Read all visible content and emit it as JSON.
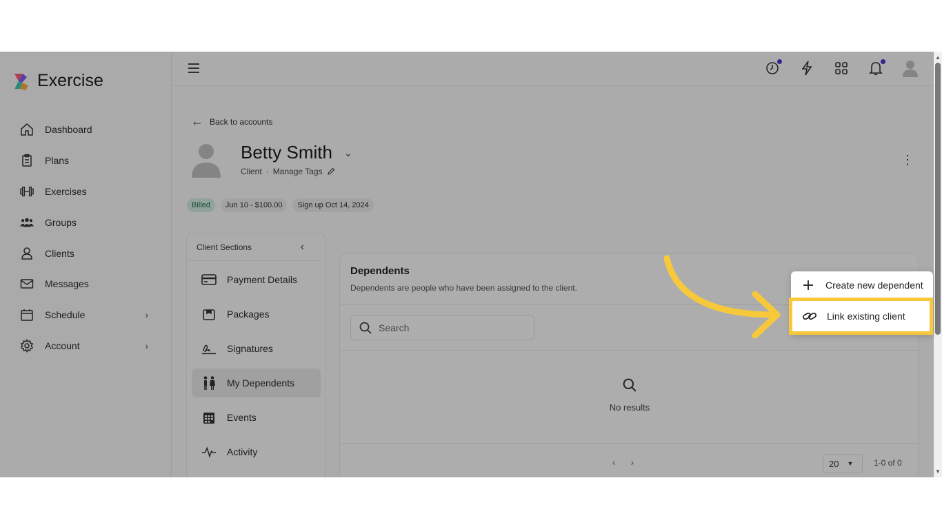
{
  "app": {
    "name": "Exercise"
  },
  "sidebar": {
    "items": [
      {
        "label": "Dashboard",
        "icon": "home-icon"
      },
      {
        "label": "Plans",
        "icon": "clipboard-icon"
      },
      {
        "label": "Exercises",
        "icon": "dumbbell-icon"
      },
      {
        "label": "Groups",
        "icon": "users-group-icon"
      },
      {
        "label": "Clients",
        "icon": "user-icon"
      },
      {
        "label": "Messages",
        "icon": "mail-icon"
      },
      {
        "label": "Schedule",
        "icon": "calendar-icon",
        "has_submenu": true
      },
      {
        "label": "Account",
        "icon": "gear-icon",
        "has_submenu": true
      }
    ]
  },
  "topbar": {
    "icons": [
      "history-icon",
      "lightning-icon",
      "apps-grid-icon",
      "bell-icon",
      "avatar-icon"
    ],
    "notification_color": "#4338ca"
  },
  "client": {
    "back_label": "Back to accounts",
    "name": "Betty Smith",
    "role": "Client",
    "separator": "·",
    "manage_tags": "Manage Tags",
    "chips": [
      "Billed",
      "Jun 10 - $100.00",
      "Sign up Oct 14, 2024"
    ]
  },
  "client_sections": {
    "title": "Client Sections",
    "items": [
      {
        "label": "Payment Details",
        "icon": "credit-card-icon"
      },
      {
        "label": "Packages",
        "icon": "package-icon"
      },
      {
        "label": "Signatures",
        "icon": "signature-icon"
      },
      {
        "label": "My Dependents",
        "icon": "family-icon",
        "active": true
      },
      {
        "label": "Events",
        "icon": "calendar-grid-icon"
      },
      {
        "label": "Activity",
        "icon": "activity-pulse-icon"
      }
    ]
  },
  "dependents": {
    "title": "Dependents",
    "description": "Dependents are people who have been assigned to the client.",
    "search_placeholder": "Search",
    "empty_text": "No results",
    "per_page": "20",
    "range": "1-0 of 0"
  },
  "dropdown": {
    "items": [
      {
        "label": "Create new dependent",
        "icon": "plus-icon"
      },
      {
        "label": "Link existing client",
        "icon": "link-icon",
        "highlighted": true
      }
    ]
  },
  "colors": {
    "highlight": "#f7c93a",
    "billed_bg": "#cfe8dc",
    "billed_text": "#2a6e4f"
  }
}
